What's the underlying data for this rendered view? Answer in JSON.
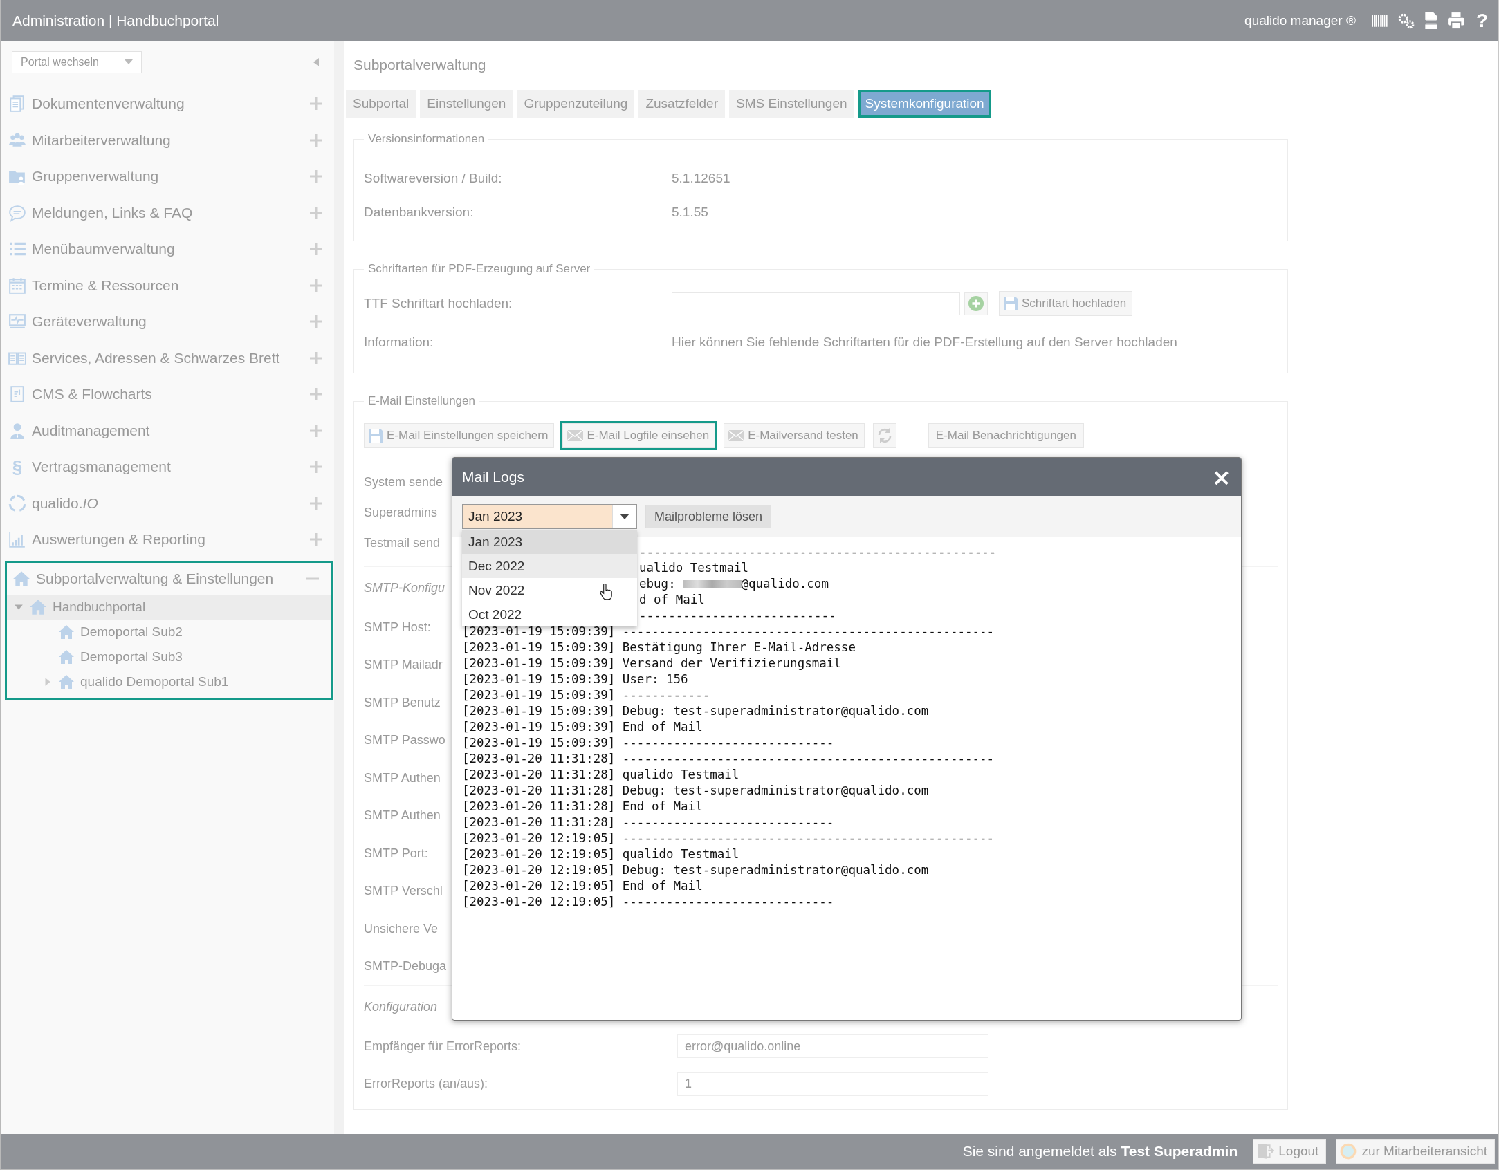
{
  "header": {
    "title": "Administration | Handbuchportal",
    "brand": "qualido manager ®",
    "help_glyph": "?"
  },
  "sidebar": {
    "portal_select": "Portal wechseln",
    "items": [
      {
        "label": "Dokumentenverwaltung",
        "expanded": false,
        "highlighted": false
      },
      {
        "label": "Mitarbeiterverwaltung",
        "expanded": false,
        "highlighted": false
      },
      {
        "label": "Gruppenverwaltung",
        "expanded": false,
        "highlighted": false
      },
      {
        "label": "Meldungen, Links & FAQ",
        "expanded": false,
        "highlighted": false
      },
      {
        "label": "Menübaumverwaltung",
        "expanded": false,
        "highlighted": false
      },
      {
        "label": "Termine & Ressourcen",
        "expanded": false,
        "highlighted": false
      },
      {
        "label": "Geräteverwaltung",
        "expanded": false,
        "highlighted": false
      },
      {
        "label": "Services, Adressen & Schwarzes Brett",
        "expanded": false,
        "highlighted": false
      },
      {
        "label": "CMS & Flowcharts",
        "expanded": false,
        "highlighted": false
      },
      {
        "label": "Auditmanagement",
        "expanded": false,
        "highlighted": false
      },
      {
        "label": "Vertragsmanagement",
        "expanded": false,
        "highlighted": false,
        "glyph": "§"
      },
      {
        "label": "qualido.*IO*",
        "expanded": false,
        "highlighted": false
      },
      {
        "label": "Auswertungen & Reporting",
        "expanded": false,
        "highlighted": false
      },
      {
        "label": "Subportalverwaltung & Einstellungen",
        "expanded": true,
        "highlighted": true,
        "children": [
          {
            "label": "Handbuchportal",
            "expanded": true,
            "selected": true,
            "children": [
              {
                "label": "Demoportal Sub2",
                "selected": false
              },
              {
                "label": "Demoportal Sub3",
                "selected": false
              },
              {
                "label": "qualido Demoportal Sub1",
                "selected": false,
                "expanded": false
              }
            ]
          }
        ]
      }
    ]
  },
  "page_title": "Subportalverwaltung",
  "tabs": [
    {
      "label": "Subportal",
      "selected": false,
      "highlighted": false
    },
    {
      "label": "Einstellungen",
      "selected": false,
      "highlighted": false
    },
    {
      "label": "Gruppenzuteilung",
      "selected": false,
      "highlighted": false
    },
    {
      "label": "Zusatzfelder",
      "selected": false,
      "highlighted": false
    },
    {
      "label": "SMS Einstellungen",
      "selected": false,
      "highlighted": false
    },
    {
      "label": "Systemkonfiguration",
      "selected": true,
      "highlighted": true
    }
  ],
  "version_info": {
    "legend": "Versionsinformationen",
    "rows": [
      {
        "label": "Softwareversion / Build:",
        "value": "5.1.12651"
      },
      {
        "label": "Datenbankversion:",
        "value": "5.1.55"
      }
    ]
  },
  "fonts": {
    "legend": "Schriftarten für PDF-Erzeugung auf Server",
    "upload_label": "TTF Schriftart hochladen:",
    "upload_button": "Schriftart hochladen",
    "info_label": "Information:",
    "info_text": "Hier können Sie fehlende Schriftarten für die PDF-Erstellung auf den Server hochladen"
  },
  "email_settings": {
    "legend": "E-Mail Einstellungen",
    "buttons": [
      {
        "kind": "save",
        "label": "E-Mail Einstellungen speichern",
        "highlighted": false
      },
      {
        "kind": "mail",
        "label": "E-Mail Logfile einsehen",
        "highlighted": true
      },
      {
        "kind": "mail",
        "label": "E-Mailversand testen",
        "highlighted": false
      },
      {
        "kind": "refresh",
        "highlighted": false
      },
      {
        "kind": "plain",
        "label": "E-Mail Benachrichtigungen",
        "highlighted": false
      }
    ],
    "groups": [
      {
        "rows": [
          {
            "kind": "field",
            "label": "System sende"
          },
          {
            "kind": "field",
            "label": "Superadmins"
          },
          {
            "kind": "field",
            "label": "Testmail send"
          }
        ]
      },
      {
        "rows": [
          {
            "kind": "heading",
            "label": "SMTP-Konfigu"
          },
          {
            "kind": "field",
            "label": "SMTP Host:"
          },
          {
            "kind": "field",
            "label": "SMTP Mailadr"
          },
          {
            "kind": "field",
            "label": "SMTP Benutz"
          },
          {
            "kind": "field",
            "label": "SMTP Passwo"
          },
          {
            "kind": "field",
            "label": "SMTP Authen"
          },
          {
            "kind": "field",
            "label": "SMTP Authen"
          },
          {
            "kind": "field",
            "label": "SMTP Port:"
          },
          {
            "kind": "field",
            "label": "SMTP Verschl"
          },
          {
            "kind": "field",
            "label": "Unsichere Ve"
          },
          {
            "kind": "field",
            "label": "SMTP-Debuga"
          }
        ]
      },
      {
        "rows": [
          {
            "kind": "heading",
            "label": "Konfiguration"
          },
          {
            "kind": "field",
            "label": "Empfänger für ErrorReports:",
            "value": "error@qualido.online"
          },
          {
            "kind": "field",
            "label": "ErrorReports (an/aus):",
            "value": "1"
          }
        ]
      }
    ]
  },
  "modal": {
    "title": "Mail Logs",
    "close_glyph": "×",
    "select": {
      "value": "Jan 2023",
      "options": [
        {
          "label": "Jan 2023",
          "selected": true,
          "hovered": false
        },
        {
          "label": "Dec 2022",
          "selected": false,
          "hovered": true
        },
        {
          "label": "Nov 2022",
          "selected": false,
          "hovered": false
        },
        {
          "label": "Oct 2022",
          "selected": false,
          "hovered": false
        }
      ]
    },
    "fix_button": "Mailprobleme lösen",
    "log_lines": [
      {
        "kind": "partial",
        "text": "-------------------------------------------------"
      },
      {
        "kind": "partial",
        "text": "ualido Testmail"
      },
      {
        "kind": "redacted",
        "text": "ebug: ",
        "tail": "@qualido.com"
      },
      {
        "kind": "partial",
        "text": "d of Mail"
      },
      {
        "kind": "partial",
        "text": "---------------------------"
      },
      {
        "kind": "full",
        "text": "[2023-01-19 15:09:39] ---------------------------------------------------"
      },
      {
        "kind": "full",
        "text": "[2023-01-19 15:09:39] Bestätigung Ihrer E-Mail-Adresse"
      },
      {
        "kind": "full",
        "text": "[2023-01-19 15:09:39] Versand der Verifizierungsmail"
      },
      {
        "kind": "full",
        "text": "[2023-01-19 15:09:39] User: 156"
      },
      {
        "kind": "full",
        "text": "[2023-01-19 15:09:39] ------------"
      },
      {
        "kind": "full",
        "text": "[2023-01-19 15:09:39] Debug: test-superadministrator@qualido.com"
      },
      {
        "kind": "full",
        "text": "[2023-01-19 15:09:39] End of Mail"
      },
      {
        "kind": "full",
        "text": "[2023-01-19 15:09:39] -----------------------------"
      },
      {
        "kind": "full",
        "text": "[2023-01-20 11:31:28] ---------------------------------------------------"
      },
      {
        "kind": "full",
        "text": "[2023-01-20 11:31:28] qualido Testmail"
      },
      {
        "kind": "full",
        "text": "[2023-01-20 11:31:28] Debug: test-superadministrator@qualido.com"
      },
      {
        "kind": "full",
        "text": "[2023-01-20 11:31:28] End of Mail"
      },
      {
        "kind": "full",
        "text": "[2023-01-20 11:31:28] -----------------------------"
      },
      {
        "kind": "full",
        "text": "[2023-01-20 12:19:05] ---------------------------------------------------"
      },
      {
        "kind": "full",
        "text": "[2023-01-20 12:19:05] qualido Testmail"
      },
      {
        "kind": "full",
        "text": "[2023-01-20 12:19:05] Debug: test-superadministrator@qualido.com"
      },
      {
        "kind": "full",
        "text": "[2023-01-20 12:19:05] End of Mail"
      },
      {
        "kind": "full",
        "text": "[2023-01-20 12:19:05] -----------------------------"
      }
    ]
  },
  "footer": {
    "login_text": "Sie sind angemeldet als **Test Superadmin**",
    "logout": "Logout",
    "employee_view": "zur Mitarbeiteransicht"
  }
}
